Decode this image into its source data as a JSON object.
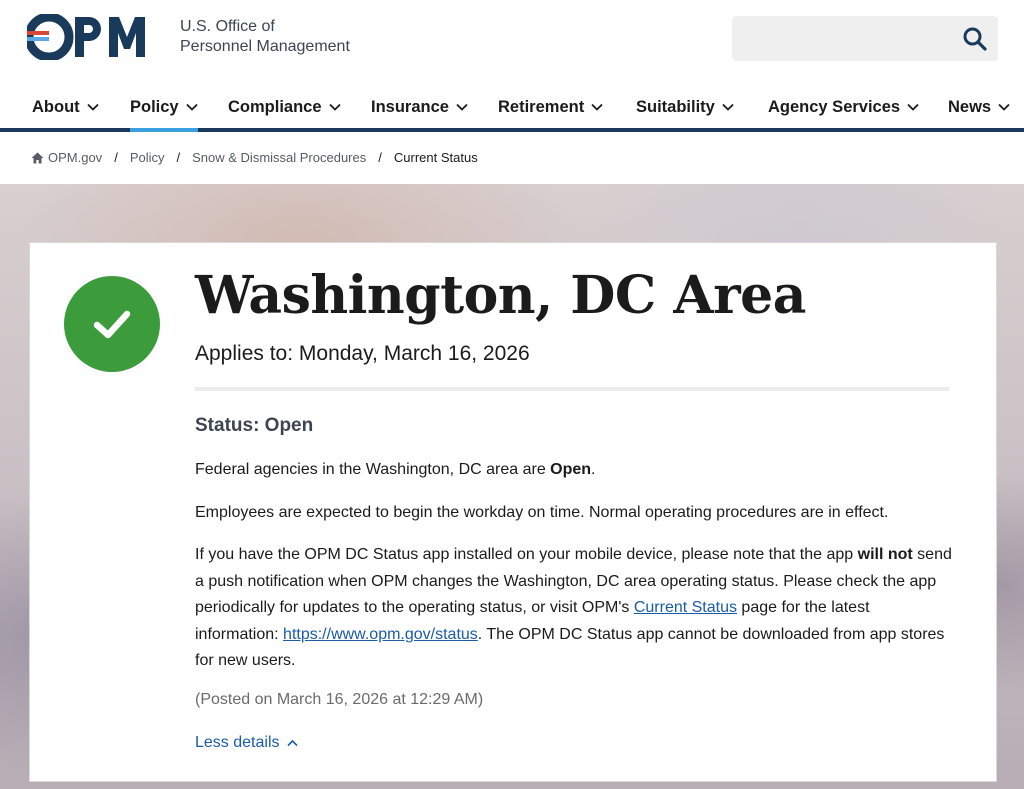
{
  "header": {
    "logo_text_line1": "U.S. Office of",
    "logo_text_line2": "Personnel Management",
    "search_placeholder": ""
  },
  "nav": {
    "items": [
      {
        "label": "About"
      },
      {
        "label": "Policy"
      },
      {
        "label": "Compliance"
      },
      {
        "label": "Insurance"
      },
      {
        "label": "Retirement"
      },
      {
        "label": "Suitability"
      },
      {
        "label": "Agency Services"
      },
      {
        "label": "News"
      }
    ],
    "active": "Policy"
  },
  "breadcrumb": {
    "items": [
      "OPM.gov",
      "Policy",
      "Snow & Dismissal Procedures"
    ],
    "current": "Current Status",
    "separator": "/"
  },
  "status_card": {
    "title": "Washington, DC Area",
    "applies": "Applies to: Monday, March 16, 2026",
    "status_heading": "Status: Open",
    "p1_before": "Federal agencies in the Washington, DC area are ",
    "p1_bold": "Open",
    "p1_after": ".",
    "p2": "Employees are expected to begin the workday on time. Normal operating procedures are in effect.",
    "p3_part1": "If you have the OPM DC Status app installed on your mobile device, please note that the app ",
    "p3_bold": "will not",
    "p3_part2": " send a push notification when OPM changes the Washington, DC area operating status. Please check the app periodically for updates to the operating status, or visit OPM's ",
    "p3_link1": "Current Status",
    "p3_part3": " page for the latest information: ",
    "p3_link2": "https://www.opm.gov/status",
    "p3_part4": ". The OPM DC Status app cannot be downloaded from app stores for new users.",
    "posted": "(Posted on March 16, 2026 at 12:29 AM)",
    "toggle_label": "Less details"
  },
  "colors": {
    "brand_navy": "#1a3a5c",
    "status_green": "#3c9c3c",
    "link_blue": "#1a5ca8",
    "nav_active": "#3aa0e0"
  }
}
